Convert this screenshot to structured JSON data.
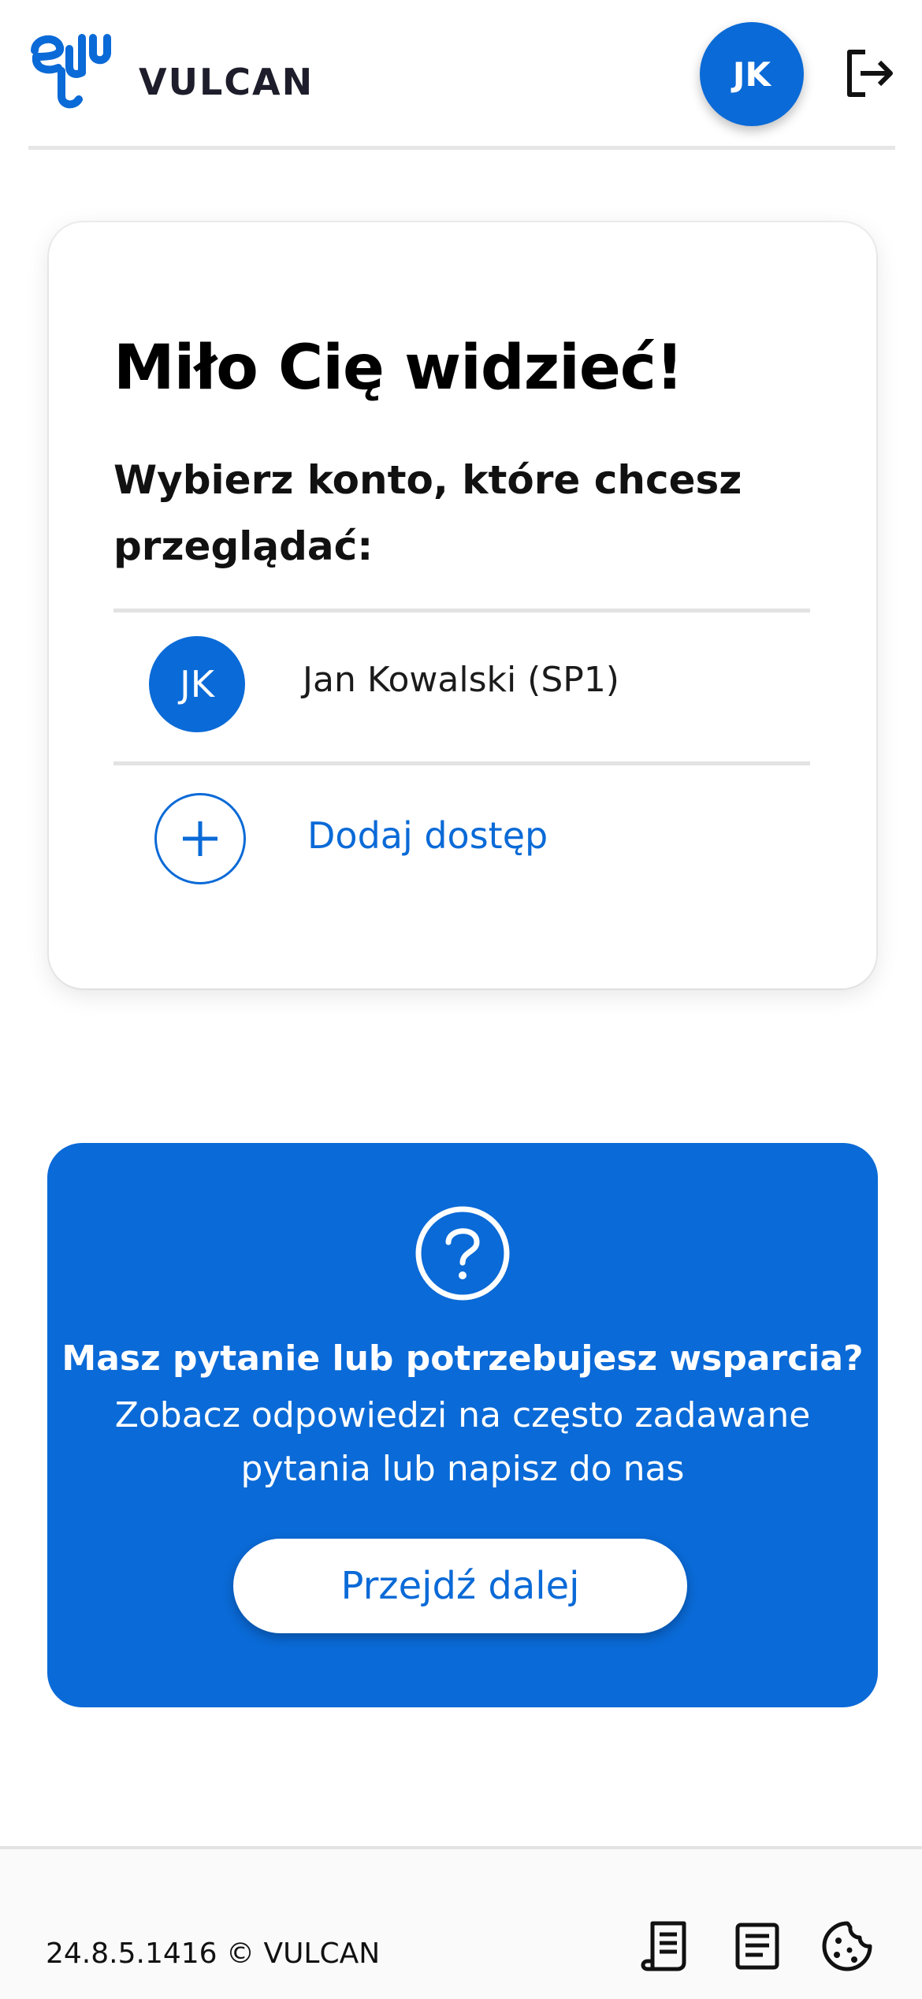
{
  "header": {
    "logo_text": "VULCAN",
    "avatar_initials": "JK",
    "logout_icon": "logout-icon"
  },
  "welcome": {
    "title": "Miło Cię widzieć!",
    "subtitle": "Wybierz konto, które chcesz przeglądać:",
    "accounts": [
      {
        "initials": "JK",
        "name": "Jan Kowalski (SP1)"
      }
    ],
    "add_access_label": "Dodaj dostęp"
  },
  "support": {
    "icon": "help-icon",
    "question": "Masz pytanie lub potrzebujesz wsparcia?",
    "description": "Zobacz odpowiedzi na często zadawane pytania lub napisz do nas",
    "button_label": "Przejdź dalej"
  },
  "footer": {
    "version": "24.8.5.1416 © VULCAN",
    "icons": [
      "scroll-icon",
      "document-icon",
      "cookie-icon"
    ]
  },
  "colors": {
    "accent": "#0a6ad7",
    "divider": "#e3e3e3"
  }
}
